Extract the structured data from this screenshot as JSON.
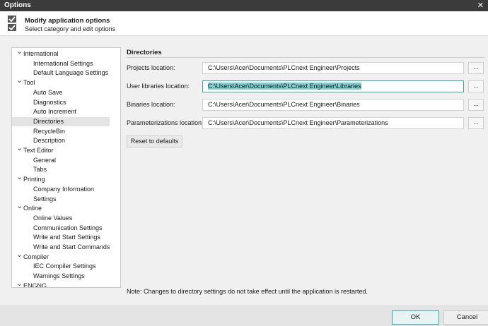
{
  "window": {
    "title": "Options",
    "close_glyph": "✕"
  },
  "header": {
    "title": "Modify application options",
    "subtitle": "Select category and edit options",
    "icon": "checkbox-list-icon"
  },
  "tree": {
    "items": [
      {
        "label": "International",
        "level": 0,
        "expanded": true
      },
      {
        "label": "International Settings",
        "level": 1
      },
      {
        "label": "Default Language Settings",
        "level": 1
      },
      {
        "label": "Tool",
        "level": 0,
        "expanded": true
      },
      {
        "label": "Auto Save",
        "level": 1
      },
      {
        "label": "Diagnostics",
        "level": 1
      },
      {
        "label": "Auto Increment",
        "level": 1
      },
      {
        "label": "Directories",
        "level": 1,
        "selected": true
      },
      {
        "label": "RecycleBin",
        "level": 1
      },
      {
        "label": "Description",
        "level": 1
      },
      {
        "label": "Text Editor",
        "level": 0,
        "expanded": true
      },
      {
        "label": "General",
        "level": 1
      },
      {
        "label": "Tabs",
        "level": 1
      },
      {
        "label": "Printing",
        "level": 0,
        "expanded": true
      },
      {
        "label": "Company Information",
        "level": 1
      },
      {
        "label": "Settings",
        "level": 1
      },
      {
        "label": "Online",
        "level": 0,
        "expanded": true
      },
      {
        "label": "Online Values",
        "level": 1
      },
      {
        "label": "Communication Settings",
        "level": 1
      },
      {
        "label": "Write and Start Settings",
        "level": 1
      },
      {
        "label": "Write and Start Commands",
        "level": 1
      },
      {
        "label": "Compiler",
        "level": 0,
        "expanded": true
      },
      {
        "label": "IEC Compiler Settings",
        "level": 1
      },
      {
        "label": "Warnings Settings",
        "level": 1
      },
      {
        "label": "ENGNG",
        "level": 0,
        "expanded": true
      }
    ]
  },
  "directories": {
    "section_title": "Directories",
    "projects": {
      "label": "Projects location:",
      "value": "C:\\Users\\Acer\\Documents\\PLCnext Engineer\\Projects"
    },
    "user_libraries": {
      "label": "User libraries location:",
      "value": "C:\\Users\\Acer\\Documents\\PLCnext Engineer\\Libraries"
    },
    "binaries": {
      "label": "Binaries location:",
      "value": "C:\\Users\\Acer\\Documents\\PLCnext Engineer\\Binaries"
    },
    "parameterizations": {
      "label": "Parameterizations location:",
      "value": "C:\\Users\\Acer\\Documents\\PLCnext Engineer\\Parameterizations"
    },
    "browse_label": "...",
    "reset_label": "Reset to defaults"
  },
  "note": "Note: Changes to directory settings do not take effect until the application is restarted.",
  "footer": {
    "ok_label": "OK",
    "cancel_label": "Cancel"
  },
  "colors": {
    "accent": "#3aa3a3",
    "selection": "#7fd0d0",
    "titlebar": "#3b3b3b"
  }
}
